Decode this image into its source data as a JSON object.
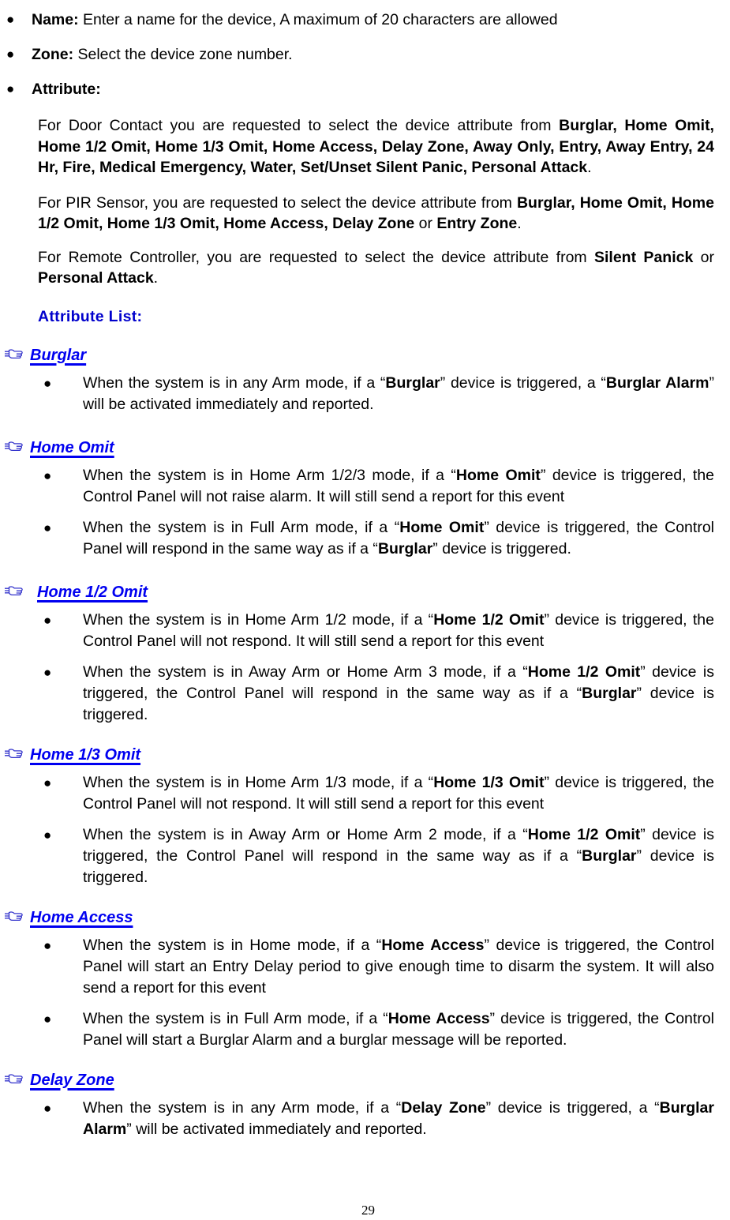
{
  "document": {
    "page_number": "29",
    "bullet_glyph": "●",
    "hand_glyph": "☞",
    "colors": {
      "heading_blue": "#0000F0",
      "attribute_list_blue": "#0000CC",
      "hand_blue": "#3333CC",
      "body_black": "#000000"
    }
  },
  "top_items": [
    {
      "label": "Name:",
      "text": " Enter a name for the device, A maximum of 20 characters are allowed"
    },
    {
      "label": "Zone:",
      "text": " Select the device zone number."
    },
    {
      "label": "Attribute:",
      "text": ""
    }
  ],
  "attribute_paragraphs": [
    {
      "id": "door-contact",
      "plain_prefix": "For Door Contact you are requested to select the device attribute from ",
      "bold_list": "Burglar, Home Omit, Home 1/2 Omit, Home 1/3 Omit, Home Access, Delay Zone, Away Only, Entry, Away Entry, 24 Hr, Fire, Medical Emergency, Water, Set/Unset Silent Panic, Personal Attack",
      "suffix": "."
    },
    {
      "id": "pir-sensor",
      "plain_prefix": "For PIR Sensor, you are requested to select the device attribute from ",
      "bold_list": "Burglar, Home Omit, Home 1/2 Omit, Home 1/3 Omit, Home Access, Delay Zone",
      "conjunction": " or ",
      "bold_tail": "Entry Zone",
      "suffix": "."
    },
    {
      "id": "remote-controller",
      "plain_prefix": "For Remote Controller, you are requested to select the device attribute from ",
      "bold_list": "Silent Panick",
      "conjunction": " or ",
      "bold_tail": "Personal Attack",
      "suffix": "."
    }
  ],
  "attribute_list_heading": "Attribute List:",
  "sections": [
    {
      "title": "Burglar",
      "bullets": [
        "When the system is in any Arm mode, if a “Burglar” device is triggered, a “Burglar Alarm” will be activated immediately and reported."
      ]
    },
    {
      "title": "Home Omit",
      "bullets": [
        "When the system is in Home Arm 1/2/3 mode, if a “Home Omit” device is triggered, the Control Panel will not raise alarm. It will still send a report for this event",
        "When the system is in Full Arm mode, if a “Home Omit” device is triggered, the Control Panel will respond in the same way as if a “Burglar” device is triggered."
      ]
    },
    {
      "title": "Home 1/2 Omit",
      "bullets": [
        "When the system is in Home Arm 1/2 mode, if a “Home 1/2 Omit” device is triggered, the Control Panel will not respond. It will still send a report for this event",
        "When the system is in Away Arm or Home Arm 3 mode, if a “Home 1/2 Omit” device is triggered, the Control Panel will respond in the same way as if a “Burglar” device is triggered."
      ]
    },
    {
      "title": "Home 1/3 Omit",
      "bullets": [
        "When the system is in Home Arm 1/3 mode, if a “Home 1/3 Omit” device is triggered, the Control Panel will not respond. It will still send a report for this event",
        "When the system is in Away Arm or Home Arm 2 mode, if a “Home 1/2 Omit” device is triggered, the Control Panel will respond in the same way as if a “Burglar” device is triggered."
      ]
    },
    {
      "title": "Home Access",
      "bullets": [
        "When the system is in Home mode, if a “Home Access” device is triggered, the Control Panel will start an Entry Delay period to give enough time to disarm the system. It will also send a report for this event",
        "When the system is in Full Arm mode, if a “Home Access” device is triggered, the Control Panel will start a Burglar Alarm and a burglar message will be reported."
      ]
    },
    {
      "title": "Delay Zone",
      "bullets": [
        "When the system is in any Arm mode, if a “Delay Zone” device is triggered, a “Burglar Alarm” will be activated immediately and reported."
      ]
    }
  ]
}
